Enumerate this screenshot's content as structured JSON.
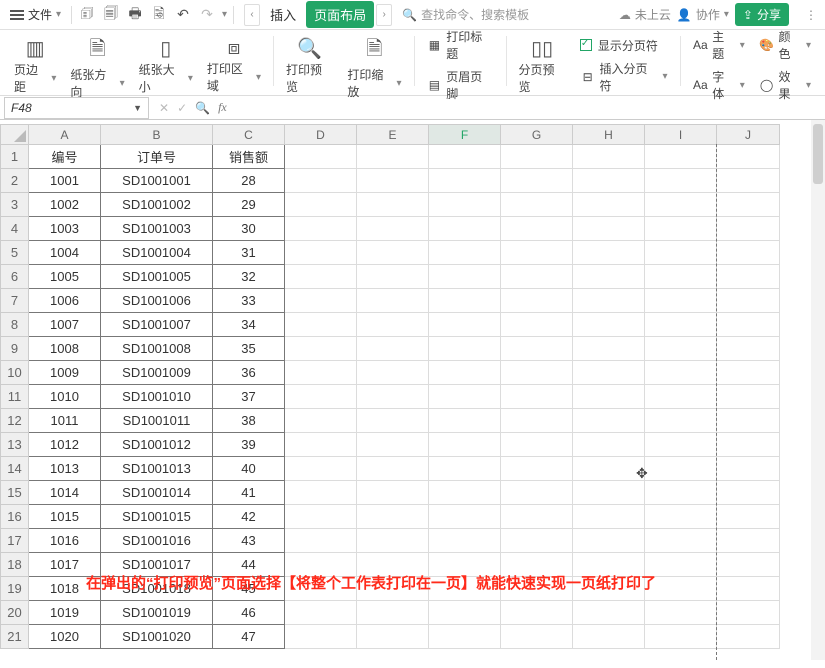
{
  "titlebar": {
    "file_label": "文件",
    "tab_insert": "插入",
    "tab_pagelayout": "页面布局",
    "search_placeholder": "查找命令、搜索模板",
    "cloud_status": "未上云",
    "collab": "协作",
    "share": "分享"
  },
  "ribbon": {
    "margins": "页边距",
    "orientation": "纸张方向",
    "size": "纸张大小",
    "print_area": "打印区域",
    "print_preview": "打印预览",
    "print_scale": "打印缩放",
    "print_titles": "打印标题",
    "header_footer": "页眉页脚",
    "page_break_preview": "分页预览",
    "show_breaks": "显示分页符",
    "insert_break": "插入分页符",
    "theme": "主题",
    "color": "颜色",
    "font": "字体",
    "effect": "效果"
  },
  "fbar": {
    "cell": "F48"
  },
  "columns": [
    "A",
    "B",
    "C",
    "D",
    "E",
    "F",
    "G",
    "H",
    "I",
    "J"
  ],
  "headers": {
    "A": "编号",
    "B": "订单号",
    "C": "销售额"
  },
  "rows": [
    {
      "n": 1,
      "A": "编号",
      "B": "订单号",
      "C": "销售额"
    },
    {
      "n": 2,
      "A": "1001",
      "B": "SD1001001",
      "C": "28"
    },
    {
      "n": 3,
      "A": "1002",
      "B": "SD1001002",
      "C": "29"
    },
    {
      "n": 4,
      "A": "1003",
      "B": "SD1001003",
      "C": "30"
    },
    {
      "n": 5,
      "A": "1004",
      "B": "SD1001004",
      "C": "31"
    },
    {
      "n": 6,
      "A": "1005",
      "B": "SD1001005",
      "C": "32"
    },
    {
      "n": 7,
      "A": "1006",
      "B": "SD1001006",
      "C": "33"
    },
    {
      "n": 8,
      "A": "1007",
      "B": "SD1001007",
      "C": "34"
    },
    {
      "n": 9,
      "A": "1008",
      "B": "SD1001008",
      "C": "35"
    },
    {
      "n": 10,
      "A": "1009",
      "B": "SD1001009",
      "C": "36"
    },
    {
      "n": 11,
      "A": "1010",
      "B": "SD1001010",
      "C": "37"
    },
    {
      "n": 12,
      "A": "1011",
      "B": "SD1001011",
      "C": "38"
    },
    {
      "n": 13,
      "A": "1012",
      "B": "SD1001012",
      "C": "39"
    },
    {
      "n": 14,
      "A": "1013",
      "B": "SD1001013",
      "C": "40"
    },
    {
      "n": 15,
      "A": "1014",
      "B": "SD1001014",
      "C": "41"
    },
    {
      "n": 16,
      "A": "1015",
      "B": "SD1001015",
      "C": "42"
    },
    {
      "n": 17,
      "A": "1016",
      "B": "SD1001016",
      "C": "43"
    },
    {
      "n": 18,
      "A": "1017",
      "B": "SD1001017",
      "C": "44"
    },
    {
      "n": 19,
      "A": "1018",
      "B": "SD1001018",
      "C": "45"
    },
    {
      "n": 20,
      "A": "1019",
      "B": "SD1001019",
      "C": "46"
    },
    {
      "n": 21,
      "A": "1020",
      "B": "SD1001020",
      "C": "47"
    }
  ],
  "annotation": "在弹出的“打印预览”页面选择【将整个工作表打印在一页】就能快速实现一页纸打印了"
}
